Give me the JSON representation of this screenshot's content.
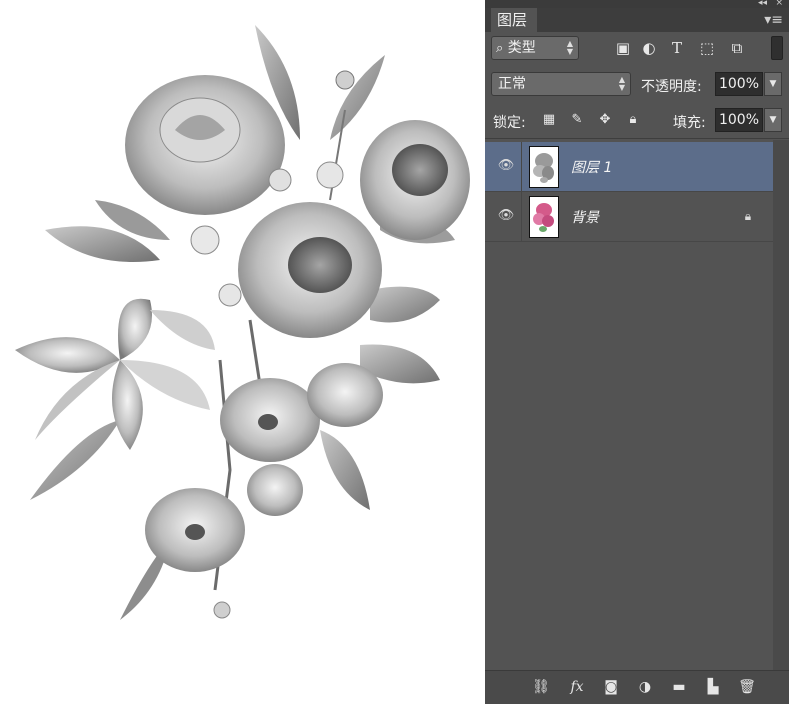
{
  "panel": {
    "tab_label": "图层",
    "filter": {
      "value": "类型"
    },
    "filter_icons": [
      "image-filter-icon",
      "adjustment-filter-icon",
      "type-filter-icon",
      "shape-filter-icon",
      "smart-object-filter-icon"
    ],
    "blend_mode": "正常",
    "opacity_label": "不透明度:",
    "opacity_value": "100%",
    "lock_label": "锁定:",
    "fill_label": "填充:",
    "fill_value": "100%",
    "layers": [
      {
        "name": "图层 1",
        "active": true,
        "visible": true,
        "locked": false
      },
      {
        "name": "背景",
        "active": false,
        "visible": true,
        "locked": true
      }
    ],
    "bottom_icons": [
      "link-layers-icon",
      "fx-icon",
      "layer-mask-icon",
      "adjustment-layer-icon",
      "group-folder-icon",
      "new-layer-icon",
      "trash-icon"
    ],
    "fx_label": "fx"
  },
  "colors": {
    "panel_bg": "#535353",
    "active_layer": "#5c6d8a",
    "canvas_bg": "#ffffff"
  }
}
